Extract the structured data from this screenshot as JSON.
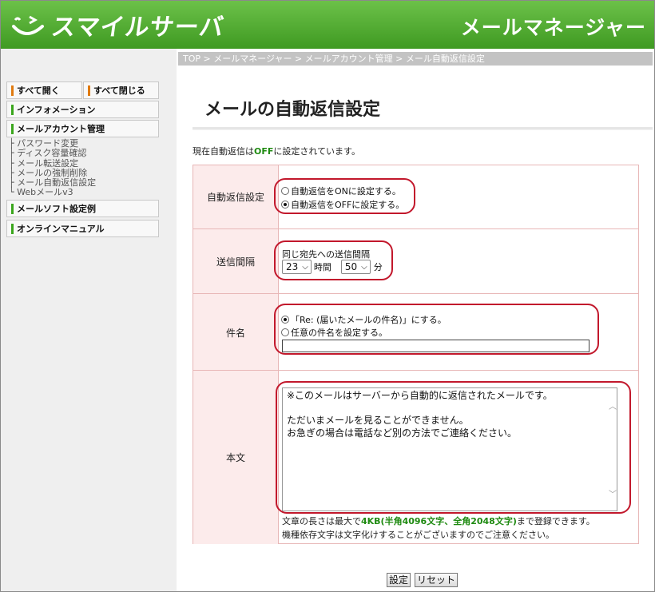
{
  "header": {
    "logo_text": "スマイルサーバ",
    "title": "メールマネージャー"
  },
  "sidebar": {
    "open_all": "すべて開く",
    "close_all": "すべて閉じる",
    "info": "インフォメーション",
    "mail_account": "メールアカウント管理",
    "sub_items": [
      "パスワード変更",
      "ディスク容量確認",
      "メール転送設定",
      "メールの強制削除",
      "メール自動返信設定",
      "Webメールv3"
    ],
    "mail_soft": "メールソフト設定例",
    "manual": "オンラインマニュアル"
  },
  "breadcrumb": "TOP > メールマネージャー > メールアカウント管理 > メール自動返信設定",
  "page_title": "メールの自動返信設定",
  "status": {
    "prefix": "現在自動返信は",
    "value": "OFF",
    "suffix": "に設定されています。"
  },
  "form": {
    "auto_reply": {
      "label": "自動返信設定",
      "option_on": "自動返信をONに設定する。",
      "option_off": "自動返信をOFFに設定する。",
      "selected": "off"
    },
    "interval": {
      "label": "送信間隔",
      "caption": "同じ宛先への送信間隔",
      "hours": "23",
      "hours_unit": "時間",
      "minutes": "50",
      "minutes_unit": "分"
    },
    "subject": {
      "label": "件名",
      "option_re": "「Re: (届いたメールの件名)」にする。",
      "option_custom": "任意の件名を設定する。",
      "selected": "re",
      "custom_value": ""
    },
    "body": {
      "label": "本文",
      "text": "※このメールはサーバーから自動的に返信されたメールです。\n\nただいまメールを見ることができません。\nお急ぎの場合は電話など別の方法でご連絡ください。",
      "note1_prefix": "文章の長さは最大で",
      "note1_limit": "4KB(半角4096文字、全角2048文字)",
      "note1_suffix": "まで登録できます。",
      "note2": "機種依存文字は文字化けすることがございますのでご注意ください。"
    }
  },
  "buttons": {
    "submit": "設定",
    "reset": "リセット"
  },
  "colors": {
    "header_green": "#4fae2c",
    "highlight_red": "#c2182c",
    "label_bg": "#fcebeb"
  }
}
